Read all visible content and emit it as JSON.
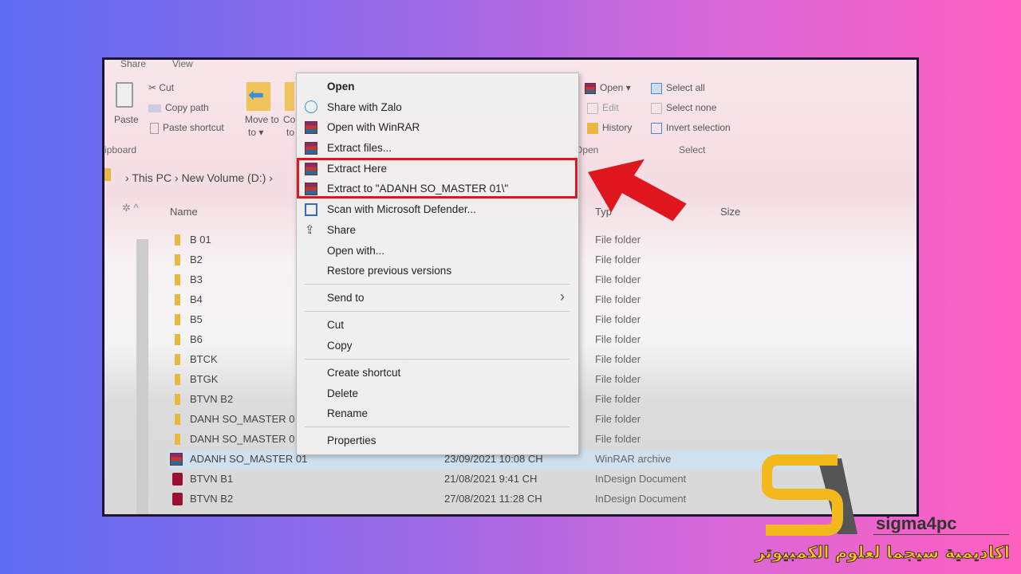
{
  "ribbon": {
    "tabs": [
      "Share",
      "View"
    ],
    "clipboard": {
      "cut": "Cut",
      "copy_path": "Copy path",
      "paste": "Paste",
      "paste_shortcut": "Paste shortcut",
      "group": "ipboard"
    },
    "organize": {
      "move_to": "Move to",
      "move_arrow": "to ▾",
      "copy_to": "Co",
      "copy_to2": "to"
    },
    "open": {
      "open": "Open ▾",
      "edit": "Edit",
      "history": "History",
      "group": "Open"
    },
    "select": {
      "all": "Select all",
      "none": "Select none",
      "invert": "Invert selection",
      "group": "Select"
    }
  },
  "breadcrumb": [
    "This PC",
    "New Volume (D:)"
  ],
  "columns": {
    "name": "Name",
    "type": "Typ",
    "size": "Size"
  },
  "files": [
    {
      "name": "B 01",
      "date": "",
      "type": "File folder",
      "icon": "folder"
    },
    {
      "name": "B2",
      "date": "",
      "type": "File folder",
      "icon": "folder"
    },
    {
      "name": "B3",
      "date": "",
      "type": "File folder",
      "icon": "folder"
    },
    {
      "name": "B4",
      "date": "",
      "type": "File folder",
      "icon": "folder"
    },
    {
      "name": "B5",
      "date": "",
      "type": "File folder",
      "icon": "folder"
    },
    {
      "name": "B6",
      "date": "",
      "type": "File folder",
      "icon": "folder"
    },
    {
      "name": "BTCK",
      "date": "",
      "type": "File folder",
      "icon": "folder"
    },
    {
      "name": "BTGK",
      "date": "",
      "type": "File folder",
      "icon": "folder"
    },
    {
      "name": "BTVN B2",
      "date": "",
      "type": "File folder",
      "icon": "folder"
    },
    {
      "name": "DANH SO_MASTER 0",
      "date": "",
      "type": "File folder",
      "icon": "folder"
    },
    {
      "name": "DANH SO_MASTER 0",
      "date": "",
      "type": "File folder",
      "icon": "folder"
    },
    {
      "name": "ADANH SO_MASTER 01",
      "date": "23/09/2021 10:08 CH",
      "type": "WinRAR archive",
      "icon": "winrar",
      "selected": true
    },
    {
      "name": "BTVN B1",
      "date": "21/08/2021 9:41 CH",
      "type": "InDesign Document",
      "icon": "indesign"
    },
    {
      "name": "BTVN B2",
      "date": "27/08/2021 11:28 CH",
      "type": "InDesign Document",
      "icon": "indesign"
    }
  ],
  "context_menu": {
    "open": "Open",
    "share_zalo": "Share with Zalo",
    "open_winrar": "Open with WinRAR",
    "extract_files": "Extract files...",
    "extract_here": "Extract Here",
    "extract_to": "Extract to \"ADANH SO_MASTER 01\\\"",
    "scan": "Scan with Microsoft Defender...",
    "share": "Share",
    "open_with": "Open with...",
    "restore": "Restore previous versions",
    "send_to": "Send to",
    "cut": "Cut",
    "copy": "Copy",
    "create_shortcut": "Create shortcut",
    "delete": "Delete",
    "rename": "Rename",
    "properties": "Properties"
  },
  "highlight_color": "#e0161e",
  "logo": {
    "brand": "sigma4pc",
    "tagline": "اكاديمية سيجما لعلوم الكمبيوتر"
  }
}
